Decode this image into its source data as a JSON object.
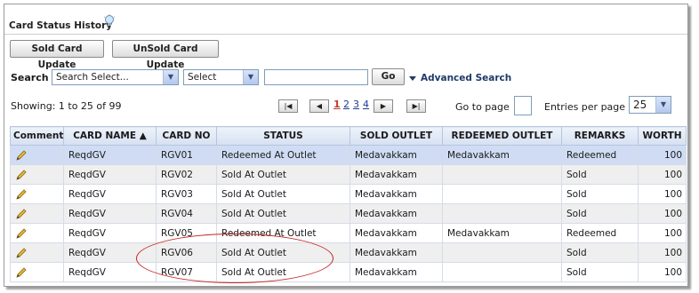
{
  "header": {
    "title": "Card Status History",
    "help_icon": "lightbulb-icon"
  },
  "toolbar": {
    "sold_update": "Sold Card Update",
    "unsold_update": "UnSold Card Update"
  },
  "search": {
    "label": "Search",
    "field_select": "Search Select...",
    "operator_select": "Select",
    "value": "",
    "go_label": "Go",
    "advanced_label": "Advanced Search"
  },
  "pagination": {
    "showing": "Showing: 1 to 25 of 99",
    "pages": [
      "1",
      "2",
      "3",
      "4"
    ],
    "current_page": "1",
    "goto_label": "Go to page",
    "goto_value": "",
    "entries_label": "Entries per page",
    "entries_value": "25"
  },
  "table": {
    "columns": [
      "Comment",
      "CARD NAME ▲",
      "CARD NO",
      "STATUS",
      "SOLD OUTLET",
      "REDEEMED OUTLET",
      "REMARKS",
      "WORTH"
    ],
    "rows": [
      {
        "card_name": "ReqdGV",
        "card_no": "RGV01",
        "status": "Redeemed At Outlet",
        "sold_outlet": "Medavakkam",
        "redeemed_outlet": "Medavakkam",
        "remarks": "Redeemed",
        "worth": "100"
      },
      {
        "card_name": "ReqdGV",
        "card_no": "RGV02",
        "status": "Sold At Outlet",
        "sold_outlet": "Medavakkam",
        "redeemed_outlet": "",
        "remarks": "Sold",
        "worth": "100"
      },
      {
        "card_name": "ReqdGV",
        "card_no": "RGV03",
        "status": "Sold At Outlet",
        "sold_outlet": "Medavakkam",
        "redeemed_outlet": "",
        "remarks": "Sold",
        "worth": "100"
      },
      {
        "card_name": "ReqdGV",
        "card_no": "RGV04",
        "status": "Sold At Outlet",
        "sold_outlet": "Medavakkam",
        "redeemed_outlet": "",
        "remarks": "Sold",
        "worth": "100"
      },
      {
        "card_name": "ReqdGV",
        "card_no": "RGV05",
        "status": "Redeemed At Outlet",
        "sold_outlet": "Medavakkam",
        "redeemed_outlet": "Medavakkam",
        "remarks": "Redeemed",
        "worth": "100"
      },
      {
        "card_name": "ReqdGV",
        "card_no": "RGV06",
        "status": "Sold At Outlet",
        "sold_outlet": "Medavakkam",
        "redeemed_outlet": "",
        "remarks": "Sold",
        "worth": "100"
      },
      {
        "card_name": "ReqdGV",
        "card_no": "RGV07",
        "status": "Sold At Outlet",
        "sold_outlet": "Medavakkam",
        "redeemed_outlet": "",
        "remarks": "Sold",
        "worth": "100"
      }
    ]
  },
  "colors": {
    "accent": "#1f3a66",
    "selected_row": "#cfdcf3",
    "annotation": "#c42424"
  }
}
